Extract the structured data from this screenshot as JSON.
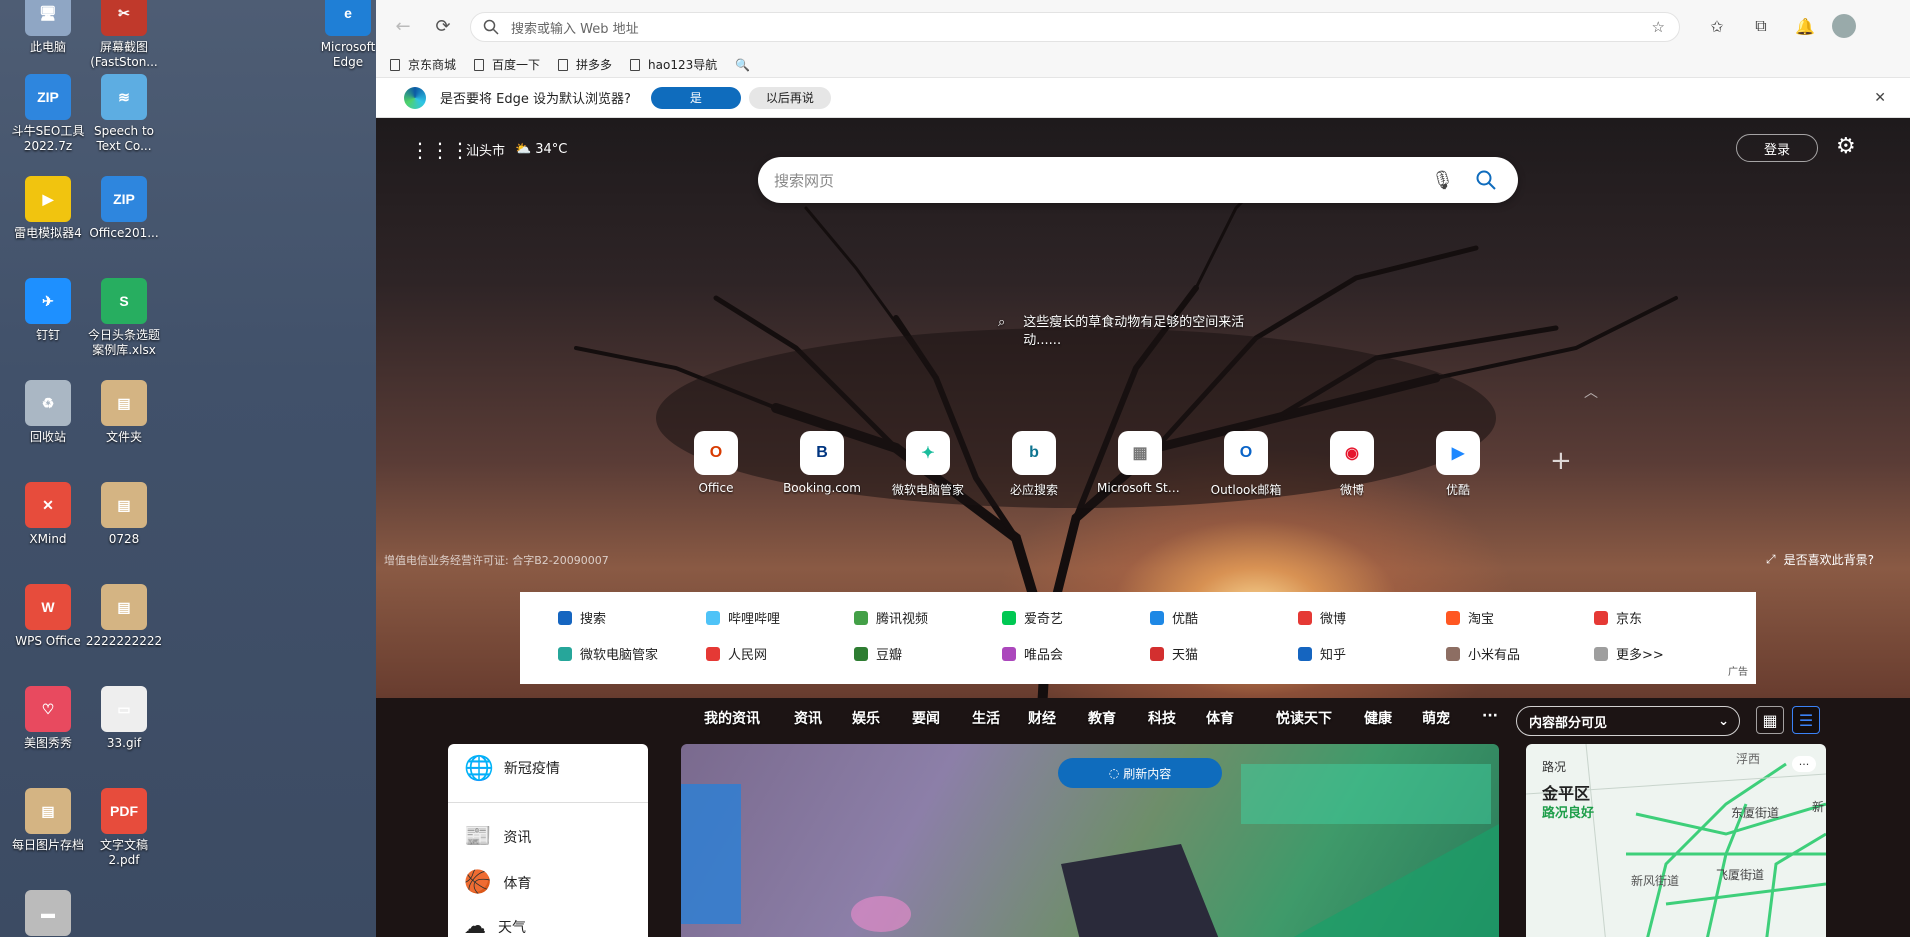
{
  "desktop": {
    "icons": [
      {
        "label": "此电脑",
        "color": "#8fa6c4",
        "glyph": "🖥"
      },
      {
        "label": "屏幕截图\n(FastSton...",
        "color": "#c0392b",
        "glyph": "✂"
      },
      {
        "label": "Microsoft\nEdge",
        "color": "#1f7fd6",
        "glyph": "e"
      },
      {
        "label": "斗牛SEO工具\n2022.7z",
        "color": "#2e86de",
        "glyph": "ZIP"
      },
      {
        "label": "Speech to\nText Co...",
        "color": "#5dade2",
        "glyph": "≋"
      },
      {
        "label": "雷电模拟器4",
        "color": "#f1c40f",
        "glyph": "▶"
      },
      {
        "label": "Office201...",
        "color": "#2e86de",
        "glyph": "ZIP"
      },
      {
        "label": "钉钉",
        "color": "#1e90ff",
        "glyph": "✈"
      },
      {
        "label": "今日头条选题\n案例库.xlsx",
        "color": "#27ae60",
        "glyph": "S"
      },
      {
        "label": "回收站",
        "color": "#aab7c4",
        "glyph": "♻"
      },
      {
        "label": "文件夹",
        "color": "#d4b483",
        "glyph": "▤"
      },
      {
        "label": "XMind",
        "color": "#e74c3c",
        "glyph": "✕"
      },
      {
        "label": "0728",
        "color": "#d4b483",
        "glyph": "▤"
      },
      {
        "label": "WPS Office",
        "color": "#e74c3c",
        "glyph": "W"
      },
      {
        "label": "2222222222",
        "color": "#d4b483",
        "glyph": "▤"
      },
      {
        "label": "美图秀秀",
        "color": "#e84a5f",
        "glyph": "♡"
      },
      {
        "label": "33.gif",
        "color": "#eeeeee",
        "glyph": "▭"
      },
      {
        "label": "每日图片存档",
        "color": "#d4b483",
        "glyph": "▤"
      },
      {
        "label": "文字文稿\n2.pdf",
        "color": "#e74c3c",
        "glyph": "PDF"
      },
      {
        "label": "",
        "color": "#bbbbbb",
        "glyph": "▬"
      }
    ]
  },
  "browser": {
    "address_placeholder": "搜索或输入 Web 地址",
    "favorites": [
      "京东商城",
      "百度一下",
      "拼多多",
      "hao123导航"
    ],
    "infobar": {
      "text": "是否要将 Edge 设为默认浏览器?",
      "yes": "是",
      "later": "以后再说"
    },
    "colors": {
      "accent": "#0f6cbd",
      "active_underline": "#3b82f6"
    }
  },
  "newtab": {
    "location": "汕头市",
    "weather": "34°C",
    "login": "登录",
    "search_placeholder": "搜索网页",
    "image_caption": "这些瘦长的草食动物有足够的空间来活动......",
    "license": "增值电信业务经营许可证: 合字B2-20090007",
    "like_bg": "是否喜欢此背景?",
    "tiles": [
      {
        "label": "Office",
        "glyph": "O",
        "color": "#d83b01"
      },
      {
        "label": "Booking.com",
        "glyph": "B",
        "color": "#003580"
      },
      {
        "label": "微软电脑管家",
        "glyph": "✦",
        "color": "#1abc9c"
      },
      {
        "label": "必应搜索",
        "glyph": "b",
        "color": "#0e7490"
      },
      {
        "label": "Microsoft Sto...",
        "glyph": "▦",
        "color": "#777777"
      },
      {
        "label": "Outlook邮箱",
        "glyph": "O",
        "color": "#0a64c8"
      },
      {
        "label": "微博",
        "glyph": "◉",
        "color": "#e6162d"
      },
      {
        "label": "优酷",
        "glyph": "▶",
        "color": "#1e88ff"
      }
    ],
    "links_row1": [
      {
        "label": "搜索",
        "color": "#1565c0"
      },
      {
        "label": "哔哩哔哩",
        "color": "#4fc3f7"
      },
      {
        "label": "腾讯视频",
        "color": "#43a047"
      },
      {
        "label": "爱奇艺",
        "color": "#00c853"
      },
      {
        "label": "优酷",
        "color": "#1e88e5"
      },
      {
        "label": "微博",
        "color": "#e53935"
      },
      {
        "label": "淘宝",
        "color": "#ff5722"
      },
      {
        "label": "京东",
        "color": "#e53935"
      }
    ],
    "links_row2": [
      {
        "label": "微软电脑管家",
        "color": "#26a69a"
      },
      {
        "label": "人民网",
        "color": "#e53935"
      },
      {
        "label": "豆瓣",
        "color": "#2e7d32"
      },
      {
        "label": "唯品会",
        "color": "#ab47bc"
      },
      {
        "label": "天猫",
        "color": "#d32f2f"
      },
      {
        "label": "知乎",
        "color": "#1565c0"
      },
      {
        "label": "小米有品",
        "color": "#8d6e63"
      },
      {
        "label": "更多>>",
        "color": "#9e9e9e"
      }
    ],
    "ad_label": "广告",
    "categories": [
      "我的资讯",
      "资讯",
      "娱乐",
      "要闻",
      "生活",
      "财经",
      "教育",
      "科技",
      "体育",
      "悦读天下",
      "健康",
      "萌宠",
      "···"
    ],
    "visibility_select": "内容部分可见",
    "left_menu": [
      "新冠疫情",
      "资讯",
      "体育",
      "天气"
    ],
    "refresh_button": "刷新内容",
    "map": {
      "title": "路况",
      "district": "金平区",
      "status": "路况良好",
      "labels": [
        "浮西",
        "东厦街道",
        "飞厦街道",
        "新风街道",
        "新"
      ]
    }
  }
}
